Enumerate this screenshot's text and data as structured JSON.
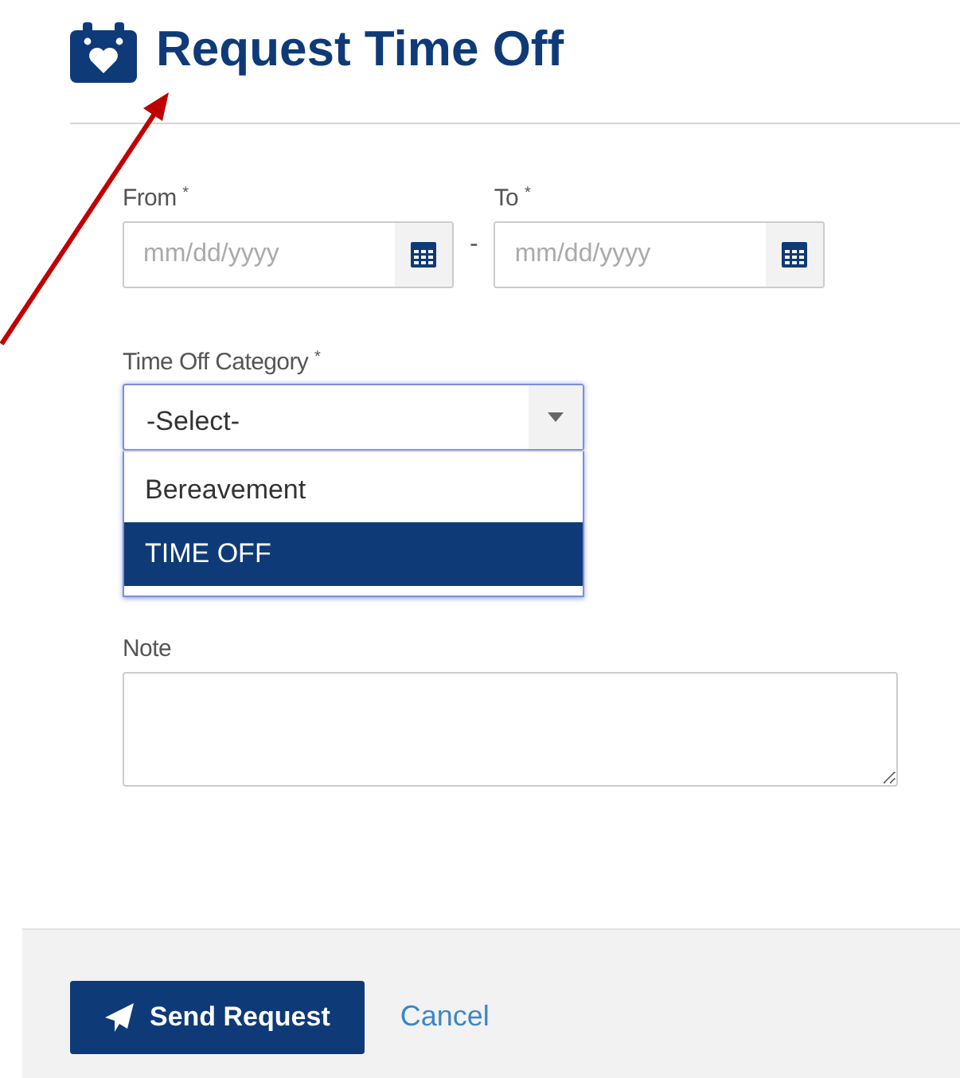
{
  "title": "Request Time Off",
  "dates": [
    {
      "label": "From",
      "required_mark": "*",
      "placeholder": "mm/dd/yyyy"
    },
    {
      "label": "To",
      "required_mark": "*",
      "placeholder": "mm/dd/yyyy"
    }
  ],
  "date_separator": "-",
  "category": {
    "label": "Time Off Category",
    "required_mark": "*",
    "value": "-Select-",
    "expanded": true,
    "options": [
      {
        "label": "Bereavement",
        "selected": false
      },
      {
        "label": "TIME OFF",
        "selected": true
      }
    ]
  },
  "note": {
    "label": "Note"
  },
  "buttons": [
    {
      "kind": "primary",
      "label": "Send Request"
    },
    {
      "kind": "link",
      "label": "Cancel"
    }
  ]
}
